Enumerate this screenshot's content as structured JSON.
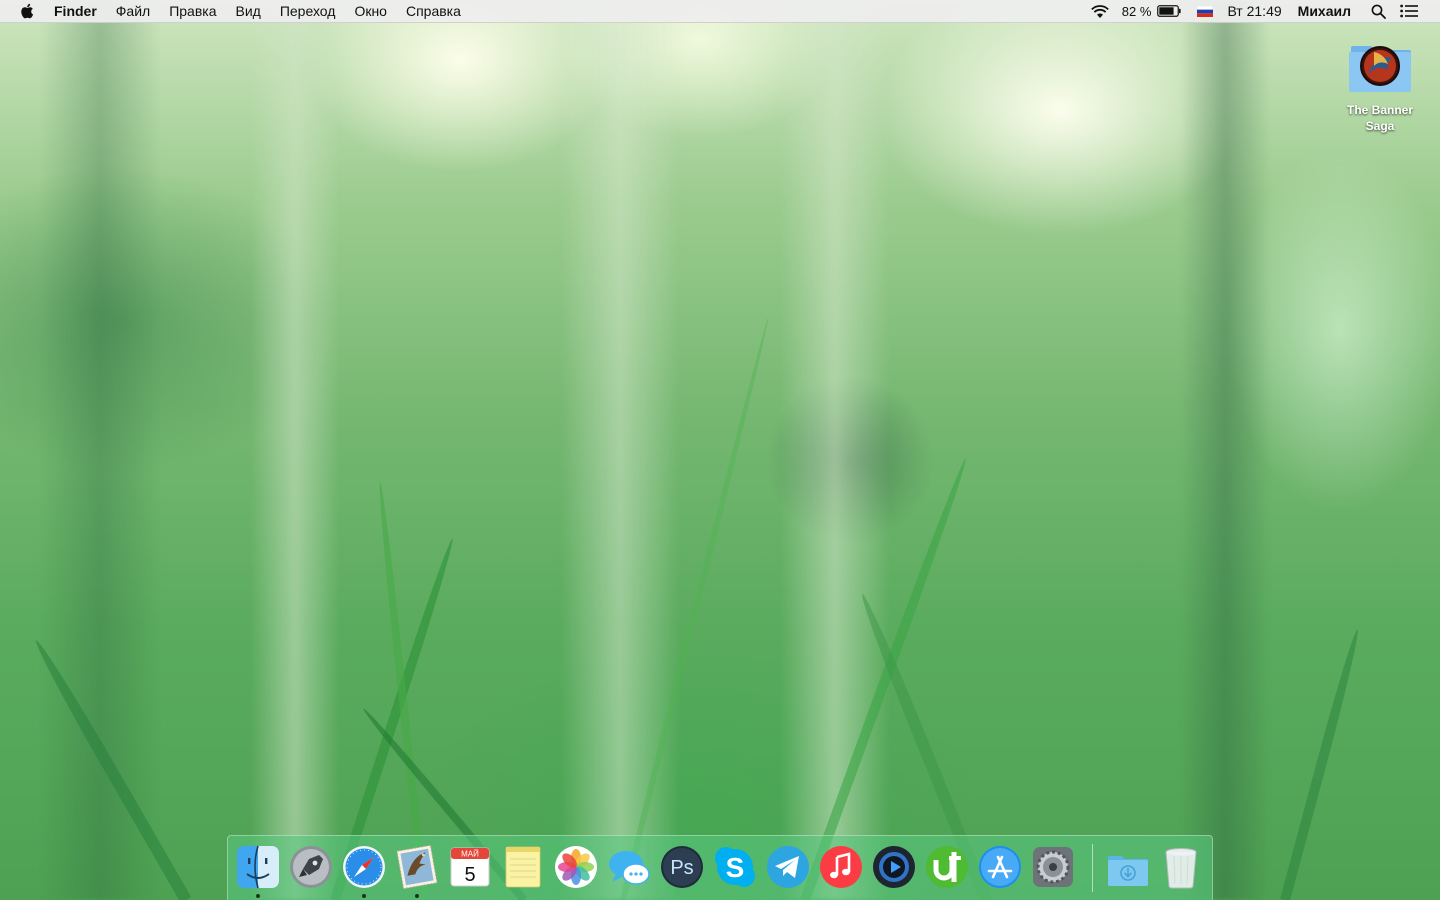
{
  "menubar": {
    "app_name": "Finder",
    "items": [
      "Файл",
      "Правка",
      "Вид",
      "Переход",
      "Окно",
      "Справка"
    ],
    "battery_percent_text": "82 %",
    "battery_level": 82,
    "clock": "Вт 21:49",
    "user": "Михаил",
    "icons": [
      "apple-icon",
      "wifi-icon",
      "battery-icon",
      "russian-flag-icon",
      "spotlight-search-icon",
      "notification-center-icon"
    ]
  },
  "desktop": {
    "items": [
      {
        "label": "The Banner Saga",
        "icon": "game-folder-icon"
      }
    ]
  },
  "dock": {
    "calendar_month": "МАЙ",
    "calendar_day": "5",
    "photoshop_letters": "Ps",
    "skype_letter": "S",
    "items": [
      {
        "icon": "finder-icon",
        "running": true
      },
      {
        "icon": "launchpad-rocket-icon",
        "running": false
      },
      {
        "icon": "safari-compass-icon",
        "running": true
      },
      {
        "icon": "mail-eagle-stamp-icon",
        "running": true
      },
      {
        "icon": "calendar-icon",
        "running": false
      },
      {
        "icon": "notes-icon",
        "running": false
      },
      {
        "icon": "photos-icon",
        "running": false
      },
      {
        "icon": "messages-icon",
        "running": false
      },
      {
        "icon": "photoshop-icon",
        "running": false
      },
      {
        "icon": "skype-icon",
        "running": false
      },
      {
        "icon": "telegram-icon",
        "running": false
      },
      {
        "icon": "itunes-icon",
        "running": false
      },
      {
        "icon": "quicktime-icon",
        "running": false
      },
      {
        "icon": "utorrent-icon",
        "running": false
      },
      {
        "icon": "app-store-icon",
        "running": false
      },
      {
        "icon": "system-preferences-gear-icon",
        "running": false
      },
      {
        "icon": "downloads-folder-icon",
        "running": false
      },
      {
        "icon": "trash-icon",
        "running": false
      }
    ]
  },
  "colors": {
    "menubar_bg": "#eeeeee",
    "dock_bg": "#5ac882",
    "telegram": "#2ca5e0",
    "skype": "#00aff0",
    "utorrent": "#4fbb32",
    "itunes": "#fc3c44"
  }
}
